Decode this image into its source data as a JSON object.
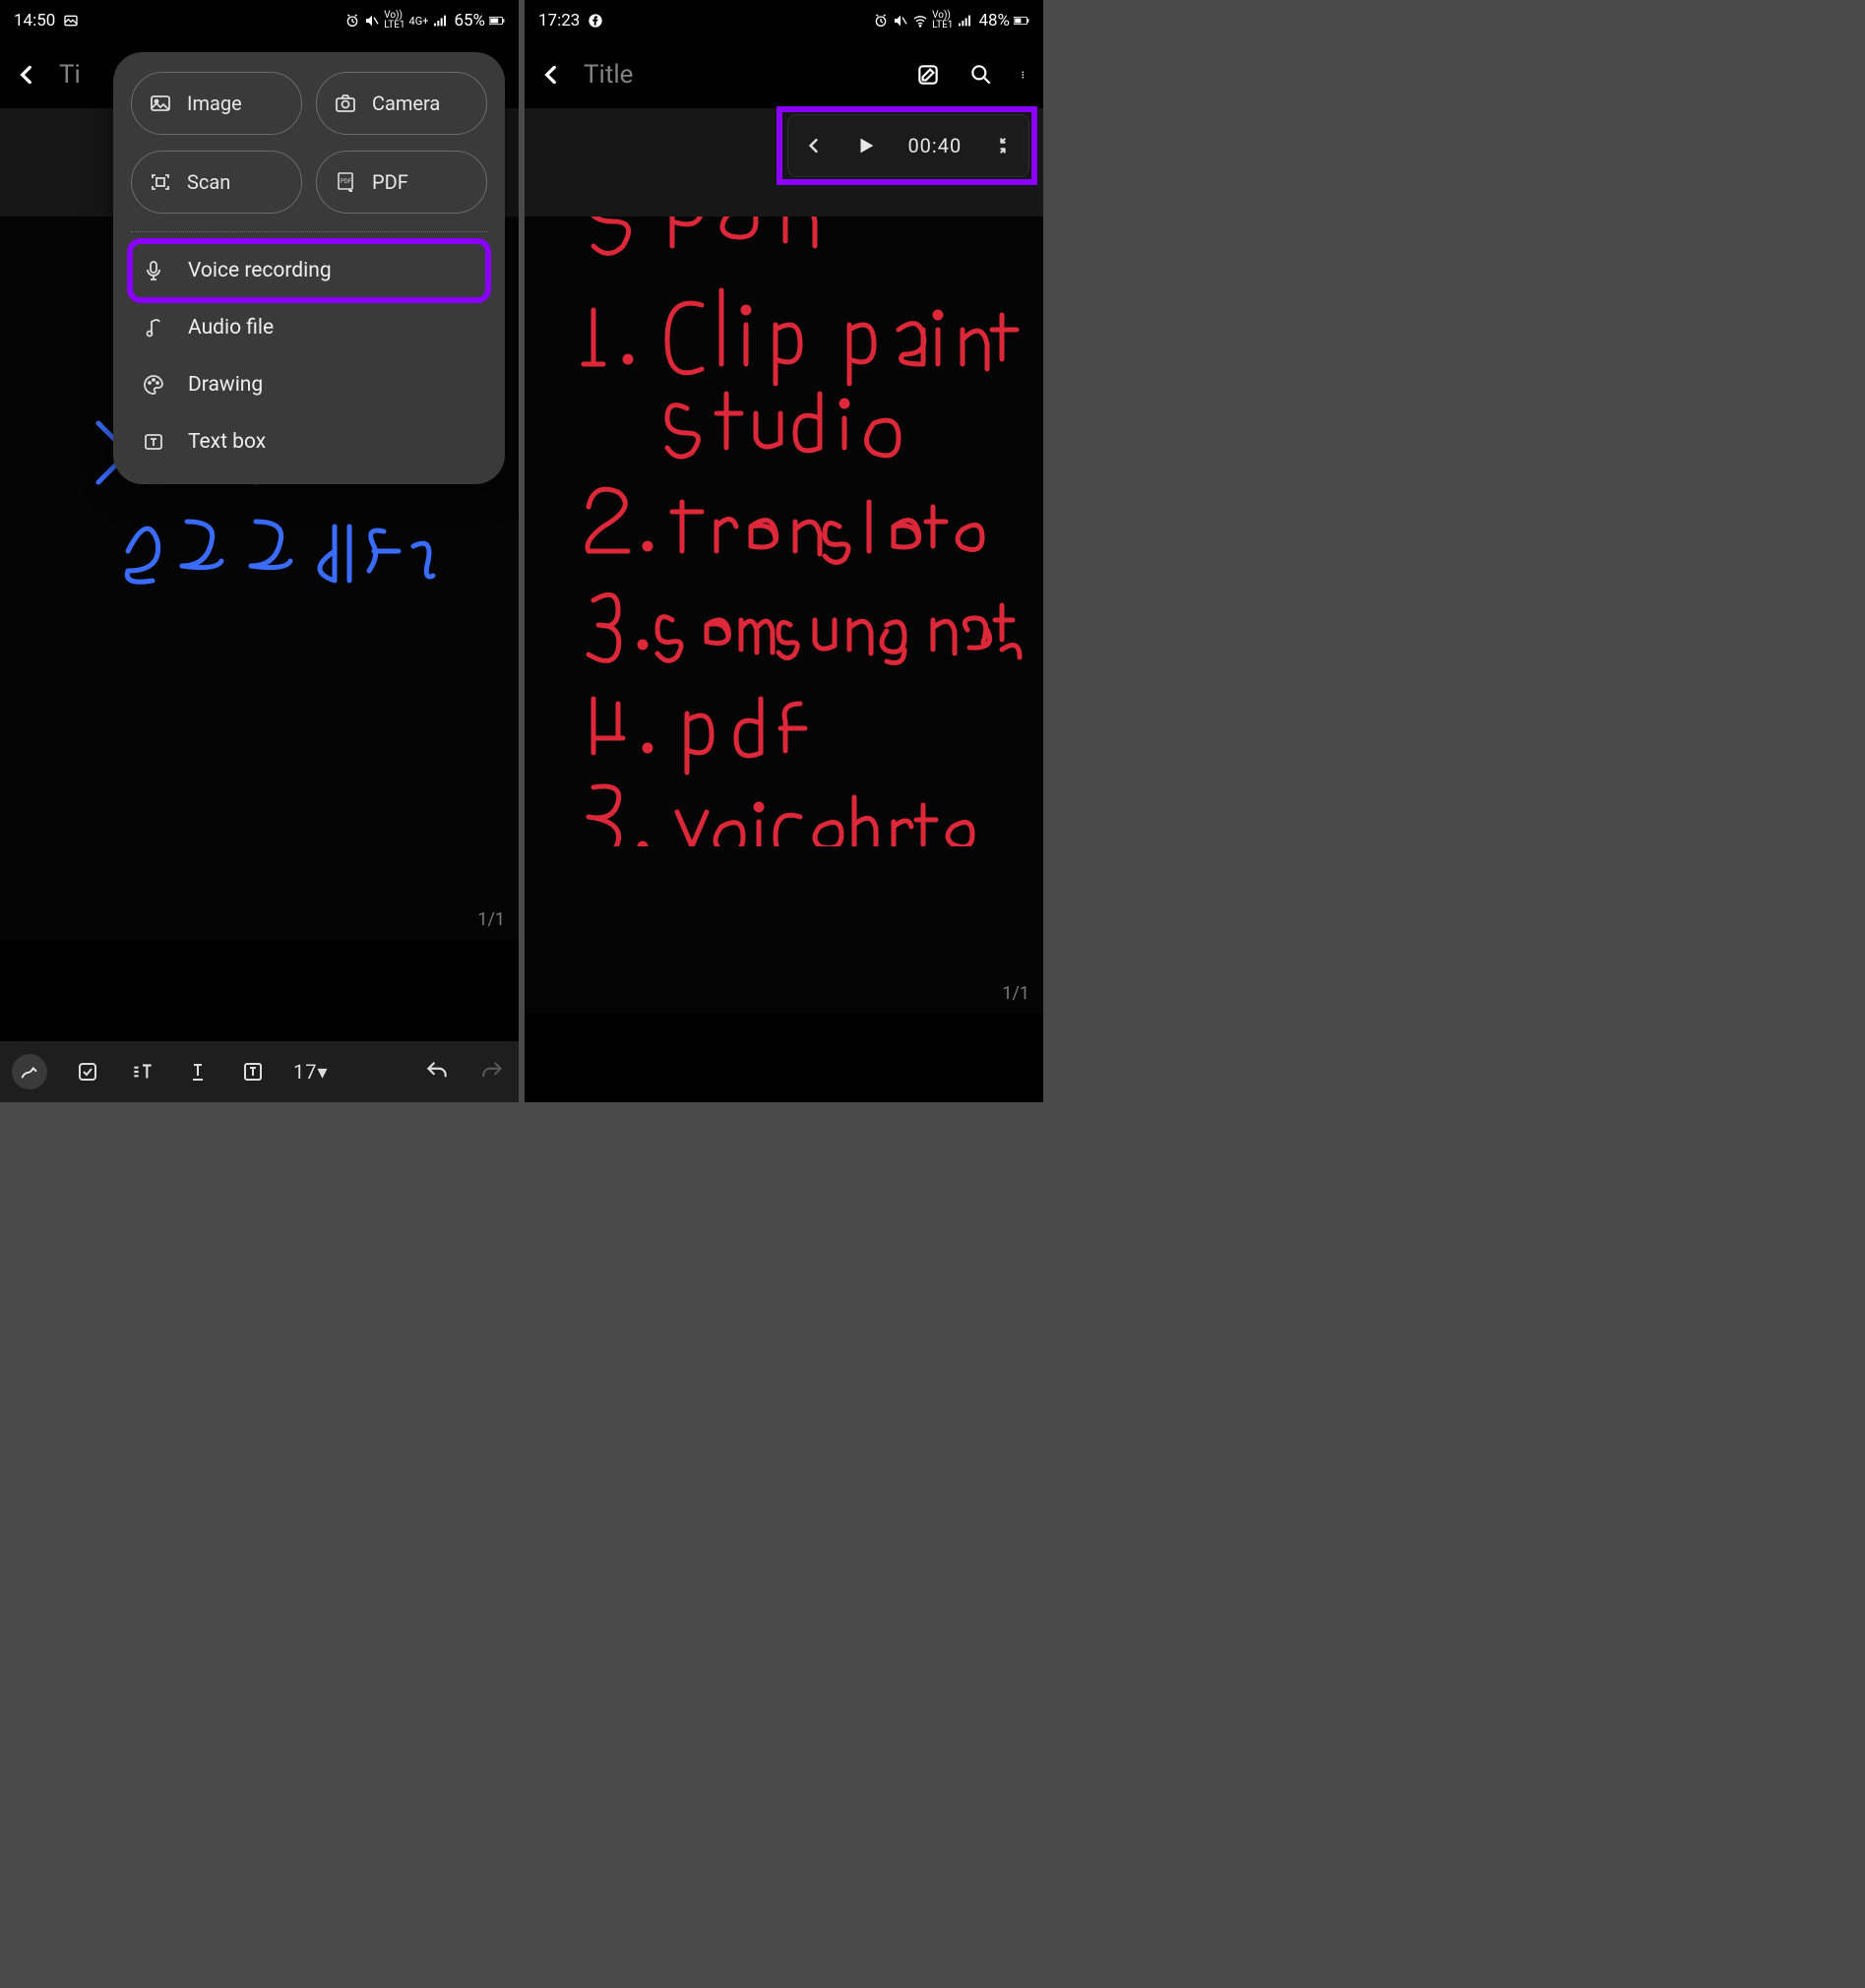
{
  "left": {
    "status": {
      "time": "14:50",
      "battery": "65%",
      "net": "4G+"
    },
    "title": "Ti",
    "menu": {
      "image": "Image",
      "camera": "Camera",
      "scan": "Scan",
      "pdf": "PDF",
      "voice": "Voice recording",
      "audio": "Audio file",
      "drawing": "Drawing",
      "textbox": "Text box"
    },
    "toolbar": {
      "fontsize": "17▾"
    },
    "page": "1/1"
  },
  "right": {
    "status": {
      "time": "17:23",
      "battery": "48%"
    },
    "title": "Title",
    "audio": {
      "time": "00:40"
    },
    "handwriting": {
      "heading": "S Pen",
      "items": [
        "Clip paint studio",
        "translate",
        "samsung note",
        "pdf",
        "voicehrte"
      ]
    },
    "page": "1/1"
  }
}
